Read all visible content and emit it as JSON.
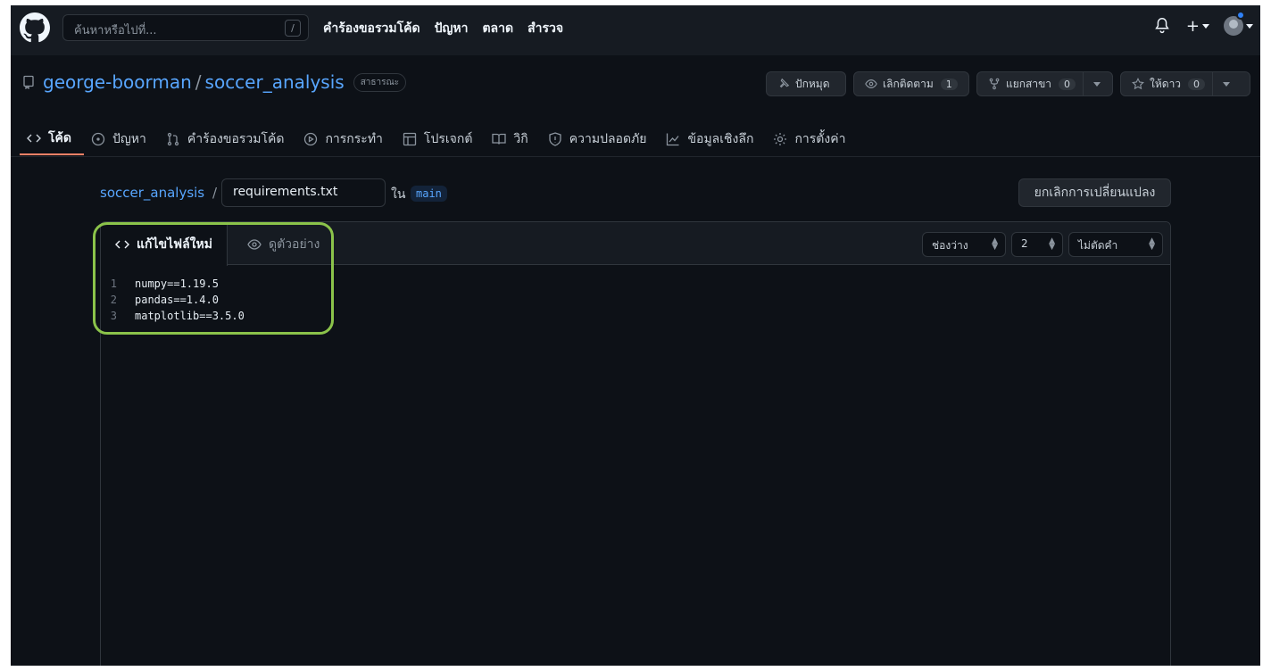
{
  "header": {
    "search_placeholder": "ค้นหาหรือไปที่...",
    "search_shortcut": "/",
    "nav": [
      "คำร้องขอรวมโค้ด",
      "ปัญหา",
      "ตลาด",
      "สำรวจ"
    ]
  },
  "repo": {
    "owner": "george-boorman",
    "separator": "/",
    "name": "soccer_analysis",
    "visibility": "สาธารณะ",
    "pin_label": "ปักหมุด",
    "unwatch_label": "เลิกติดตาม",
    "watch_count": "1",
    "fork_label": "แยกสาขา",
    "fork_count": "0",
    "star_label": "ให้ดาว",
    "star_count": "0"
  },
  "tabs": [
    "โค้ด",
    "ปัญหา",
    "คำร้องขอรวมโค้ด",
    "การกระทำ",
    "โปรเจกต์",
    "วิกิ",
    "ความปลอดภัย",
    "ข้อมูลเชิงลึก",
    "การตั้งค่า"
  ],
  "path": {
    "repo": "soccer_analysis",
    "separator": "/",
    "filename": "requirements.txt",
    "in_label": "ใน",
    "branch": "main",
    "cancel_label": "ยกเลิกการเปลี่ยนแปลง"
  },
  "editor": {
    "edit_tab": "แก้ไขไฟล์ใหม่",
    "preview_tab": "ดูตัวอย่าง",
    "indent_mode": "ช่องว่าง",
    "indent_size": "2",
    "wrap_mode": "ไม่ตัดคำ",
    "lines": [
      {
        "n": "1",
        "text": "numpy==1.19.5"
      },
      {
        "n": "2",
        "text": "pandas==1.4.0"
      },
      {
        "n": "3",
        "text": "matplotlib==3.5.0"
      }
    ]
  },
  "colors": {
    "accent_link": "#58a6ff",
    "active_tab_underline": "#f78166",
    "highlight": "#8bc34a",
    "background": "#0d1117"
  }
}
